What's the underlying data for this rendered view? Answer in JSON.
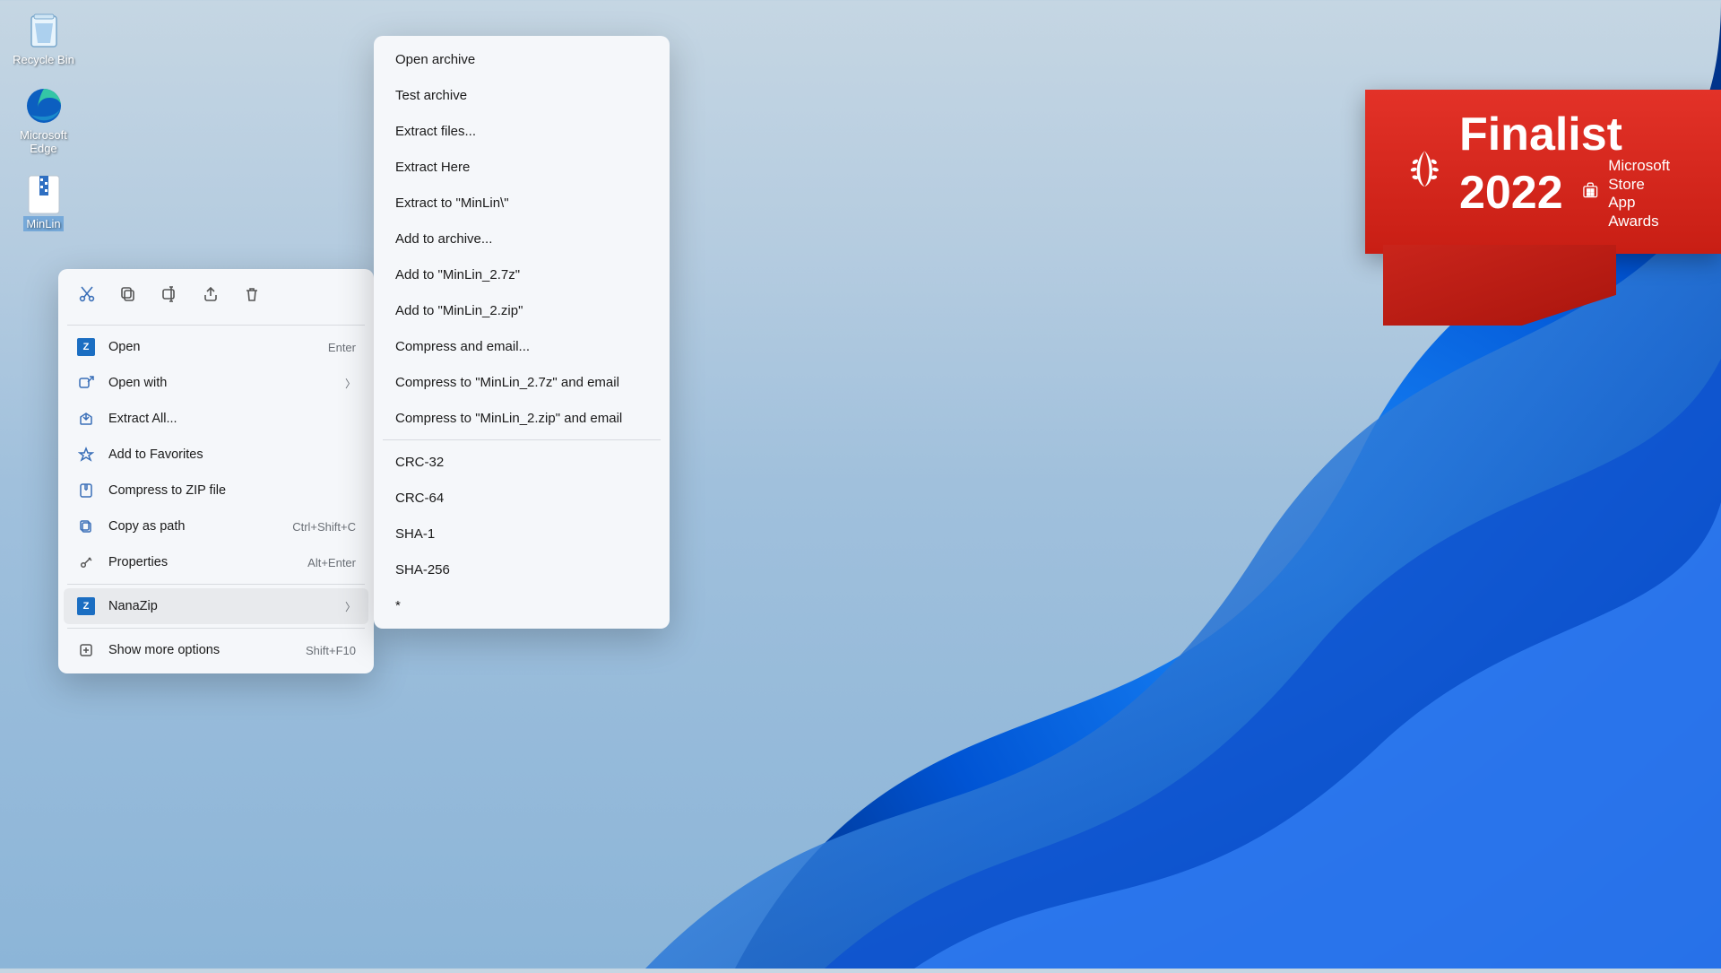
{
  "desktop_icons": [
    {
      "name": "recycle-bin",
      "label": "Recycle Bin"
    },
    {
      "name": "edge",
      "label": "Microsoft\nEdge"
    },
    {
      "name": "minlin",
      "label": "MinLin"
    }
  ],
  "context_menu": {
    "toolbar": [
      "cut",
      "copy",
      "rename",
      "share",
      "delete"
    ],
    "items": [
      {
        "icon": "open-icon",
        "label": "Open",
        "accel": "Enter"
      },
      {
        "icon": "openwith-icon",
        "label": "Open with",
        "chevron": true
      },
      {
        "icon": "extract-icon",
        "label": "Extract All..."
      },
      {
        "icon": "star-icon",
        "label": "Add to Favorites"
      },
      {
        "icon": "zip-icon",
        "label": "Compress to ZIP file"
      },
      {
        "icon": "copypath-icon",
        "label": "Copy as path",
        "accel": "Ctrl+Shift+C"
      },
      {
        "icon": "properties-icon",
        "label": "Properties",
        "accel": "Alt+Enter"
      }
    ],
    "nanazip": {
      "icon": "nanazip-icon",
      "label": "NanaZip",
      "chevron": true
    },
    "more": {
      "icon": "more-icon",
      "label": "Show more options",
      "accel": "Shift+F10"
    }
  },
  "submenu": {
    "group1": [
      "Open archive",
      "Test archive",
      "Extract files...",
      "Extract Here",
      "Extract to \"MinLin\\\"",
      "Add to archive...",
      "Add to \"MinLin_2.7z\"",
      "Add to \"MinLin_2.zip\"",
      "Compress and email...",
      "Compress to \"MinLin_2.7z\" and email",
      "Compress to \"MinLin_2.zip\" and email"
    ],
    "group2": [
      "CRC-32",
      "CRC-64",
      "SHA-1",
      "SHA-256",
      "*"
    ]
  },
  "badge": {
    "line1": "Finalist",
    "line2": "2022",
    "sub1": "Microsoft Store",
    "sub2": "App Awards"
  }
}
